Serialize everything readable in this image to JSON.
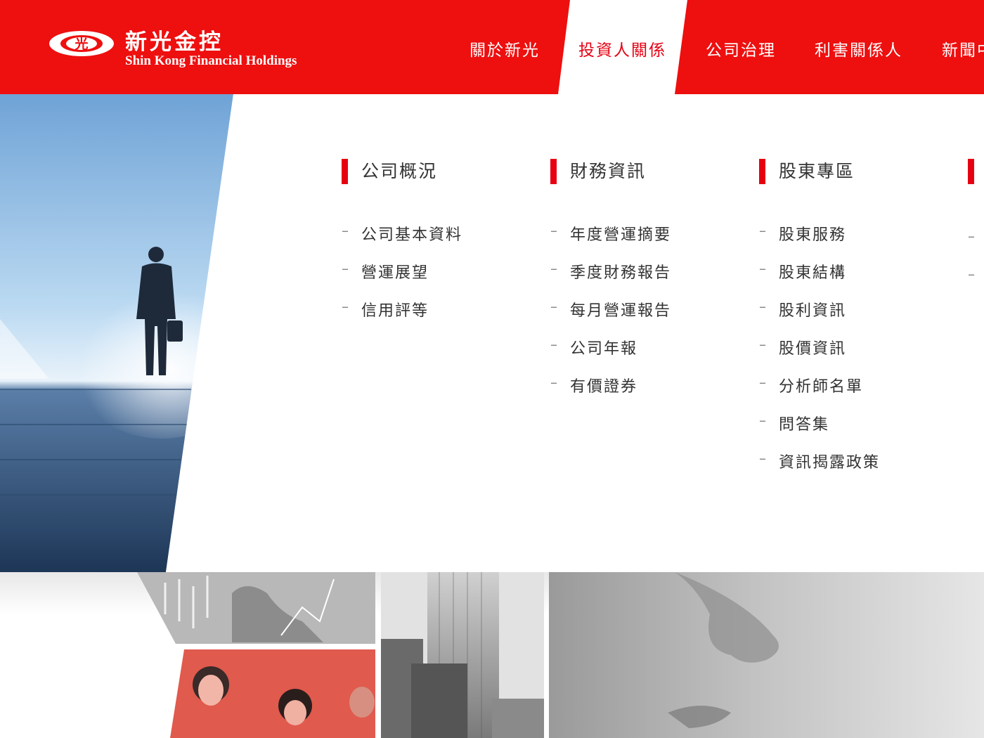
{
  "brand": {
    "logo_glyph": "光",
    "name_cn": "新光金控",
    "name_en": "Shin Kong Financial Holdings"
  },
  "nav": [
    {
      "label": "關於新光",
      "active": false
    },
    {
      "label": "投資人關係",
      "active": true
    },
    {
      "label": "公司治理",
      "active": false
    },
    {
      "label": "利害關係人",
      "active": false
    },
    {
      "label": "新聞中",
      "active": false
    }
  ],
  "menu": {
    "columns": [
      {
        "title": "公司概況",
        "items": [
          "公司基本資料",
          "營運展望",
          "信用評等"
        ]
      },
      {
        "title": "財務資訊",
        "items": [
          "年度營運摘要",
          "季度財務報告",
          "每月營運報告",
          "公司年報",
          "有價證券"
        ]
      },
      {
        "title": "股東專區",
        "items": [
          "股東服務",
          "股東結構",
          "股利資訊",
          "股價資訊",
          "分析師名單",
          "問答集",
          "資訊揭露政策"
        ]
      }
    ],
    "dash": "–"
  },
  "colors": {
    "brand_red": "#ee0f0f",
    "accent_red": "#e60012",
    "text": "#333333"
  },
  "images": [
    "businessman-stairs-photo",
    "stock-chart-hand-photo",
    "team-meeting-photo",
    "skyscraper-photo",
    "face-closeup-photo"
  ]
}
